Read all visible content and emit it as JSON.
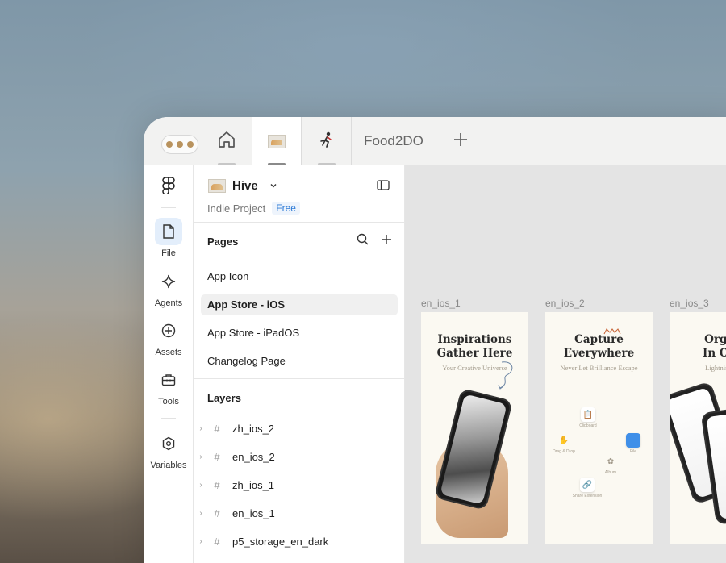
{
  "tabs": {
    "food_label": "Food2DO"
  },
  "rail": {
    "items": [
      {
        "label": "File"
      },
      {
        "label": "Agents"
      },
      {
        "label": "Assets"
      },
      {
        "label": "Tools"
      },
      {
        "label": "Variables"
      }
    ]
  },
  "project": {
    "name": "Hive",
    "team": "Indie Project",
    "plan": "Free"
  },
  "pages": {
    "title": "Pages",
    "items": [
      "App Icon",
      "App Store - iOS",
      "App Store - iPadOS",
      "Changelog Page"
    ],
    "active_index": 1
  },
  "layers": {
    "title": "Layers",
    "items": [
      "zh_ios_2",
      "en_ios_2",
      "zh_ios_1",
      "en_ios_1",
      "p5_storage_en_dark"
    ]
  },
  "canvas": {
    "frames": [
      {
        "label": "en_ios_1",
        "title_line1": "Inspirations",
        "title_line2": "Gather Here",
        "subtitle": "Your Creative Universe"
      },
      {
        "label": "en_ios_2",
        "title_line1": "Capture",
        "title_line2": "Everywhere",
        "subtitle": "Never Let Brilliance Escape"
      },
      {
        "label": "en_ios_3",
        "title_line1": "Organ",
        "title_line2": "In One",
        "subtitle": "Lightning-Fa"
      }
    ],
    "features": [
      "Clipboard",
      "Drag & Drop",
      "File",
      "Album",
      "Share Extension"
    ]
  },
  "colors": {
    "accent": "#2e7bd6",
    "active_rail": "#e3eefb",
    "canvas": "#e4e4e4"
  }
}
